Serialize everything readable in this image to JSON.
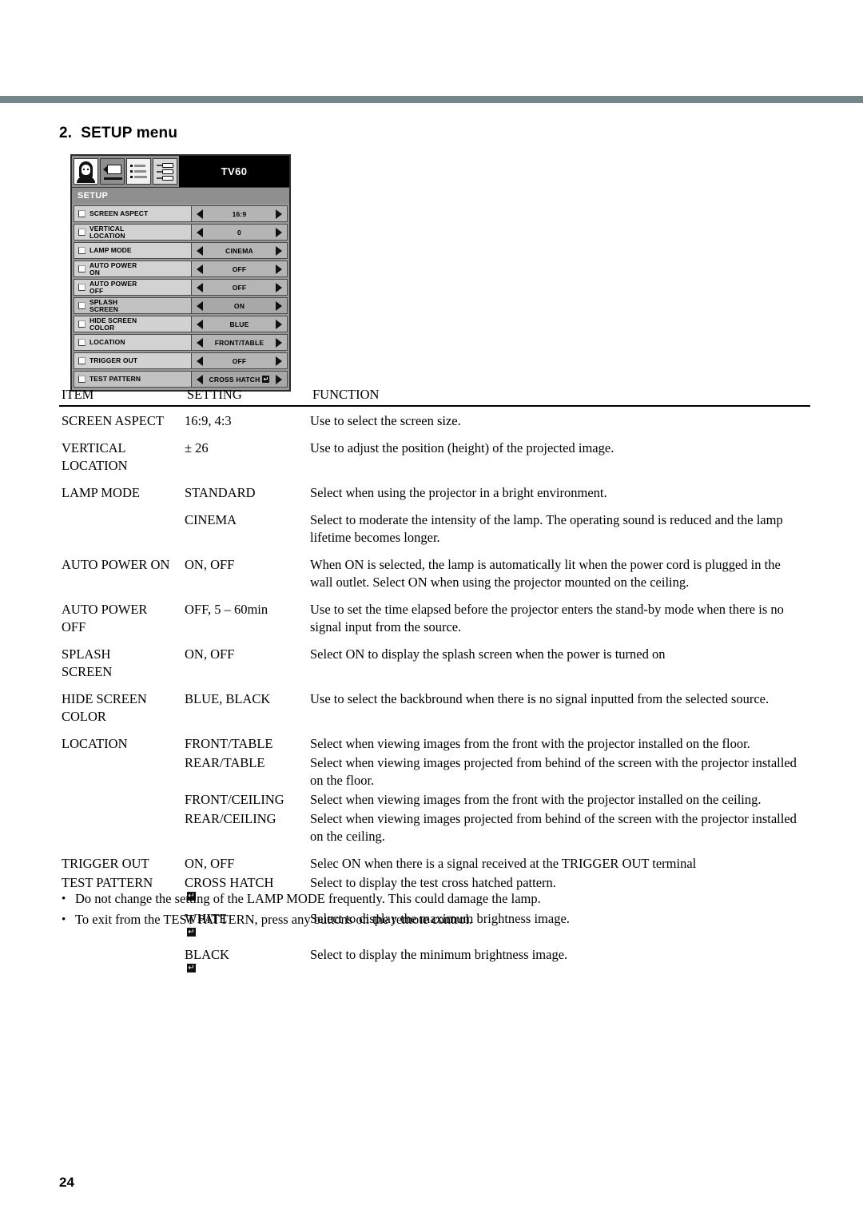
{
  "page": {
    "section_number": "2.",
    "section_title": "SETUP menu",
    "page_number": "24",
    "rule_color": "#75858a"
  },
  "osd": {
    "model_label": "TV60",
    "menu_title": "SETUP",
    "icons": [
      {
        "name": "picture-icon",
        "label": "PICTURE"
      },
      {
        "name": "projector-icon",
        "label": "PROJECTOR"
      },
      {
        "name": "menu-list-icon",
        "label": "MENU MODE RESET",
        "lines": [
          "MENU",
          "MODE",
          "RESET"
        ]
      },
      {
        "name": "terminals-icon",
        "label": "TERMINALS"
      }
    ],
    "rows": [
      {
        "label_lines": [
          "SCREEN ASPECT"
        ],
        "value": "16:9",
        "has_return_glyph": false
      },
      {
        "label_lines": [
          "VERTICAL",
          "LOCATION"
        ],
        "value": "0",
        "has_return_glyph": false
      },
      {
        "label_lines": [
          "LAMP MODE"
        ],
        "value": "CINEMA",
        "has_return_glyph": false
      },
      {
        "label_lines": [
          "AUTO POWER",
          "ON"
        ],
        "value": "OFF",
        "has_return_glyph": false
      },
      {
        "label_lines": [
          "AUTO POWER",
          "OFF"
        ],
        "value": "OFF",
        "has_return_glyph": false
      },
      {
        "label_lines": [
          "SPLASH",
          "SCREEN"
        ],
        "value": "ON",
        "has_return_glyph": false
      },
      {
        "label_lines": [
          "HIDE SCREEN",
          "COLOR"
        ],
        "value": "BLUE",
        "has_return_glyph": false
      },
      {
        "label_lines": [
          "LOCATION"
        ],
        "value": "FRONT/TABLE",
        "has_return_glyph": false
      },
      {
        "label_lines": [
          "TRIGGER OUT"
        ],
        "value": "OFF",
        "has_return_glyph": false
      },
      {
        "label_lines": [
          "TEST PATTERN"
        ],
        "value": "CROSS HATCH",
        "has_return_glyph": true
      }
    ],
    "return_glyph": "↵"
  },
  "table": {
    "headers": {
      "item": "ITEM",
      "setting": "SETTING",
      "function": "FUNCTION"
    },
    "rows": [
      {
        "item_lines": [
          "SCREEN ASPECT"
        ],
        "setting_lines": [
          "16:9, 4:3"
        ],
        "setting_glyph": false,
        "function_lines": [
          "Use to select the screen size."
        ]
      },
      {
        "item_lines": [
          "VERTICAL",
          "LOCATION"
        ],
        "setting_lines": [
          "± 26"
        ],
        "setting_glyph": false,
        "function_lines": [
          "Use to adjust the position (height) of the projected image."
        ]
      },
      {
        "item_lines": [
          "LAMP MODE"
        ],
        "setting_lines": [
          "STANDARD"
        ],
        "setting_glyph": false,
        "function_lines": [
          "Select when using the projector in a bright environment."
        ]
      },
      {
        "item_lines": [
          ""
        ],
        "setting_lines": [
          "CINEMA"
        ],
        "setting_glyph": false,
        "function_lines": [
          "Select to moderate the intensity of the lamp. The operating sound is reduced and the lamp",
          "lifetime becomes longer."
        ]
      },
      {
        "item_lines": [
          "AUTO POWER ON"
        ],
        "setting_lines": [
          "ON, OFF"
        ],
        "setting_glyph": false,
        "function_lines": [
          "When ON is selected, the lamp is automatically lit when the power cord is plugged in the",
          "wall outlet. Select ON when using the projector mounted on the ceiling."
        ]
      },
      {
        "item_lines": [
          "AUTO POWER",
          "OFF"
        ],
        "setting_lines": [
          "OFF, 5 – 60min"
        ],
        "setting_glyph": false,
        "function_lines": [
          "Use to set the time elapsed before the projector enters the stand-by mode when there is no",
          "signal input from the source."
        ]
      },
      {
        "item_lines": [
          "SPLASH",
          "SCREEN"
        ],
        "setting_lines": [
          "ON, OFF"
        ],
        "setting_glyph": false,
        "function_lines": [
          "Select ON to display the splash screen when the power is turned on"
        ]
      },
      {
        "item_lines": [
          "HIDE SCREEN",
          "COLOR"
        ],
        "setting_lines": [
          "BLUE, BLACK"
        ],
        "setting_glyph": false,
        "function_lines": [
          "Use to select the backbround when there is no signal inputted from the selected source."
        ]
      },
      {
        "item_lines": [
          "LOCATION"
        ],
        "setting_lines": [
          "FRONT/TABLE"
        ],
        "setting_glyph": false,
        "function_lines": [
          "Select when viewing images from the front with the projector installed on the floor."
        ]
      },
      {
        "item_lines": [
          ""
        ],
        "setting_lines": [
          "REAR/TABLE"
        ],
        "setting_glyph": false,
        "function_lines": [
          "Select when viewing images projected from behind of the screen with the projector installed",
          "on the floor."
        ]
      },
      {
        "item_lines": [
          ""
        ],
        "setting_lines": [
          "FRONT/CEILING"
        ],
        "setting_glyph": false,
        "function_lines": [
          "Select when viewing images from the front with the projector installed on the ceiling."
        ]
      },
      {
        "item_lines": [
          ""
        ],
        "setting_lines": [
          "REAR/CEILING"
        ],
        "setting_glyph": false,
        "function_lines": [
          "Select when viewing images projected from behind of the screen with the projector installed",
          "on the ceiling."
        ]
      },
      {
        "item_lines": [
          "TRIGGER OUT"
        ],
        "setting_lines": [
          "ON, OFF"
        ],
        "setting_glyph": false,
        "function_lines": [
          "Selec ON when there is a signal received at the TRIGGER OUT terminal"
        ]
      },
      {
        "item_lines": [
          "TEST PATTERN"
        ],
        "setting_lines": [
          "CROSS HATCH"
        ],
        "setting_glyph": true,
        "function_lines": [
          "Select to display the test cross hatched pattern."
        ]
      },
      {
        "item_lines": [
          ""
        ],
        "setting_lines": [
          "WHITE"
        ],
        "setting_glyph": true,
        "function_lines": [
          "Select to display the maximum brightness image."
        ]
      },
      {
        "item_lines": [
          ""
        ],
        "setting_lines": [
          "BLACK"
        ],
        "setting_glyph": true,
        "function_lines": [
          "Select to display the minimum brightness image."
        ]
      }
    ]
  },
  "notes": {
    "bullet": "•",
    "items": [
      "Do not change the setting of the LAMP MODE frequently. This could damage the lamp.",
      "To exit from the TEST PATTERN, press any buttons on the remote control."
    ]
  }
}
